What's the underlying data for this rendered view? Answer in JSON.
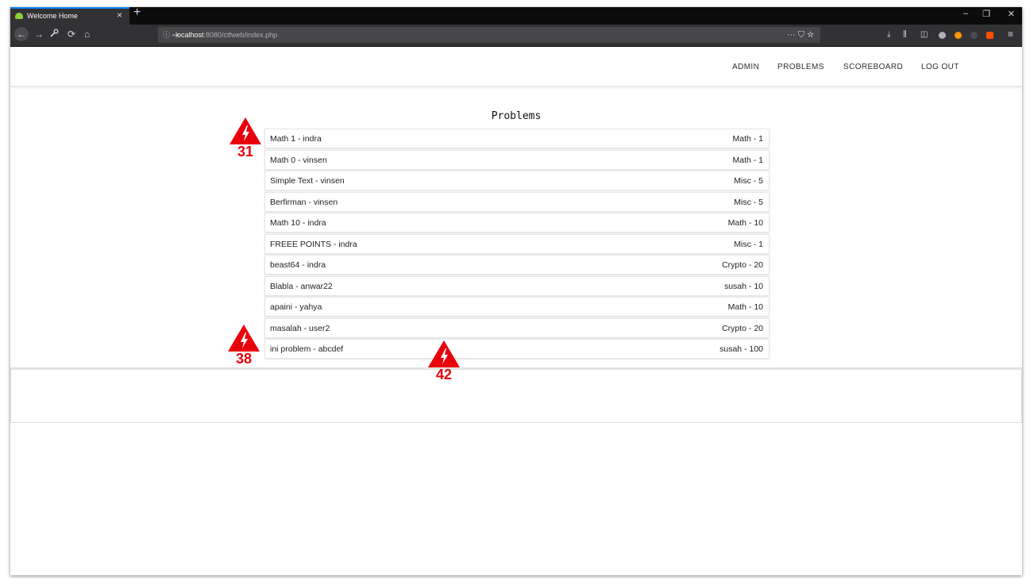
{
  "browser": {
    "tab_title": "Welcome Home",
    "tab_close": "×",
    "new_tab": "+",
    "url_host": "localhost",
    "url_rest": ":8080/ctfweb/index.php",
    "url_actions": "··· ⛉ ☆",
    "window_controls": {
      "minimize": "–",
      "restore": "❐",
      "close": "✕"
    },
    "toolbar_icons": [
      "download-icon",
      "library-icon",
      "sidebar-icon",
      "extension-icon",
      "firefox-account-icon",
      "menu-icon"
    ]
  },
  "nav": {
    "items": [
      "ADMIN",
      "PROBLEMS",
      "SCOREBOARD",
      "LOG OUT"
    ]
  },
  "main": {
    "heading": "Problems",
    "problems": [
      {
        "name": "Math 1 - indra",
        "category": "Math - 1"
      },
      {
        "name": "Math 0 - vinsen",
        "category": "Math - 1"
      },
      {
        "name": "Simple Text - vinsen",
        "category": "Misc - 5"
      },
      {
        "name": "Berfirman - vinsen",
        "category": "Misc - 5"
      },
      {
        "name": "Math 10 - indra",
        "category": "Math - 10"
      },
      {
        "name": "FREEE POINTS - indra",
        "category": "Misc - 1"
      },
      {
        "name": "beast64 - indra",
        "category": "Crypto - 20"
      },
      {
        "name": "Blabla - anwar22",
        "category": "susah - 10"
      },
      {
        "name": "apaini - yahya",
        "category": "Math - 10"
      },
      {
        "name": "masalah - user2",
        "category": "Crypto - 20"
      },
      {
        "name": "ini problem - abcdef",
        "category": "susah - 100"
      }
    ]
  },
  "markers": [
    {
      "label": "31"
    },
    {
      "label": "38"
    },
    {
      "label": "42"
    }
  ],
  "colors": {
    "marker_red": "#e8000b",
    "tab_accent": "#0a84ff"
  }
}
